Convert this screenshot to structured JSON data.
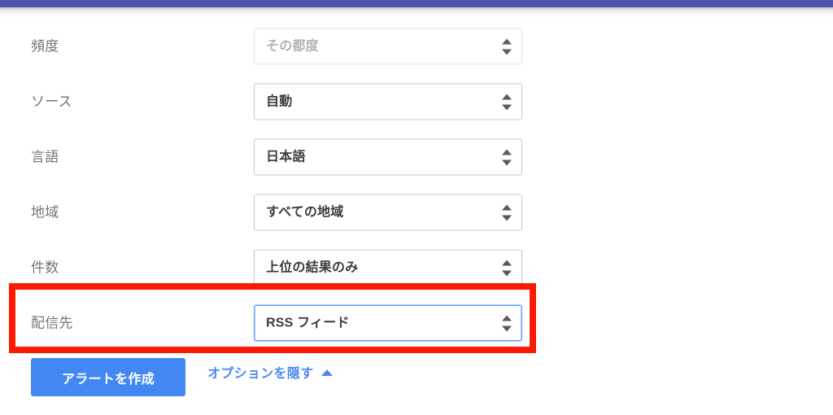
{
  "browser_chrome": {
    "top_bar_color": "#4a53ad"
  },
  "colors": {
    "accent_blue": "#4388f2",
    "link_blue": "#4e88ef",
    "focus_border": "#5b9dfa",
    "highlight_red": "#fb1a04",
    "label_grey": "#757575",
    "value_dark": "#3c3c3c",
    "disabled_grey": "#b3b3b3"
  },
  "form": {
    "rows": [
      {
        "label": "頻度",
        "name": "frequency",
        "value": "その都度",
        "state": "disabled"
      },
      {
        "label": "ソース",
        "name": "source",
        "value": "自動",
        "state": "enabled"
      },
      {
        "label": "言語",
        "name": "language",
        "value": "日本語",
        "state": "enabled"
      },
      {
        "label": "地域",
        "name": "region",
        "value": "すべての地域",
        "state": "enabled"
      },
      {
        "label": "件数",
        "name": "count",
        "value": "上位の結果のみ",
        "state": "enabled"
      },
      {
        "label": "配信先",
        "name": "deliver-to",
        "value": "RSS フィード",
        "state": "focused"
      }
    ]
  },
  "actions": {
    "create_alert_label": "アラートを作成",
    "hide_options_label": "オプションを隠す",
    "hide_options_caret_icon": "caret-up-icon"
  },
  "annotation": {
    "type": "highlight-rectangle",
    "target_row": "配信先",
    "color": "#fb1a04"
  }
}
